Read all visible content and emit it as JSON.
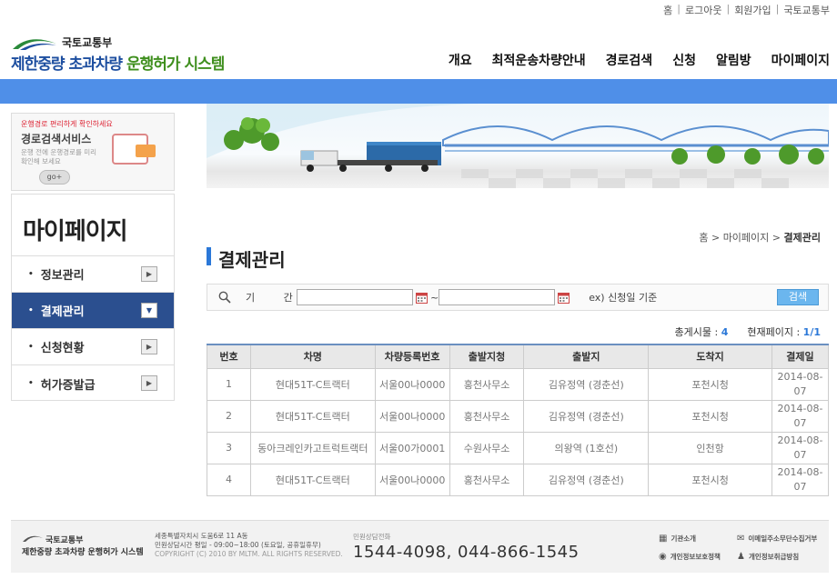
{
  "util_links": [
    "홈",
    "로그아웃",
    "회원가입",
    "국토교통부"
  ],
  "header": {
    "ministry": "국토교통부",
    "system_name_a": "제한중량 초과차량 ",
    "system_name_b": "운행허가 시스템"
  },
  "gnb": [
    "개요",
    "최적운송차량안내",
    "경로검색",
    "신청",
    "알림방",
    "마이페이지"
  ],
  "promo": {
    "subtitle": "운행경로 편리하게 확인하세요",
    "title": "경로검색서비스",
    "desc": "운행 전에 운행경로를 미리 확인해 보세요",
    "go": "go+"
  },
  "sidebar": {
    "title": "마이페이지",
    "items": [
      {
        "label": "정보관리",
        "active": false
      },
      {
        "label": "결제관리",
        "active": true
      },
      {
        "label": "신청현황",
        "active": false
      },
      {
        "label": "허가증발급",
        "active": false
      }
    ]
  },
  "breadcrumb": {
    "home": "홈",
    "sep": ">",
    "level1": "마이페이지",
    "current": "결제관리"
  },
  "page_title": "결제관리",
  "search": {
    "period_label": "기 간 :",
    "start_value": "",
    "end_value": "",
    "tilde": "~",
    "example": "ex) 신청일 기준",
    "button": "검색"
  },
  "counts": {
    "total_label": "총게시물 :",
    "total": "4",
    "page_label": "현재페이지 :",
    "page": "1/1"
  },
  "table": {
    "headers": [
      "번호",
      "차명",
      "차량등록번호",
      "출발지청",
      "출발지",
      "도착지",
      "결제일"
    ],
    "rows": [
      [
        "1",
        "현대51T-C트랙터",
        "서울00나0000",
        "홍천사무소",
        "김유정역 (경춘선)",
        "포천시청",
        "2014-08-07"
      ],
      [
        "2",
        "현대51T-C트랙터",
        "서울00나0000",
        "홍천사무소",
        "김유정역 (경춘선)",
        "포천시청",
        "2014-08-07"
      ],
      [
        "3",
        "동아크레인카고트럭트랙터",
        "서울00가0001",
        "수원사무소",
        "의왕역 (1호선)",
        "인천항",
        "2014-08-07"
      ],
      [
        "4",
        "현대51T-C트랙터",
        "서울00나0000",
        "홍천사무소",
        "김유정역 (경춘선)",
        "포천시청",
        "2014-08-07"
      ]
    ]
  },
  "footer": {
    "ministry": "국토교통부",
    "system": "제한중량 초과차량 운행허가 시스템",
    "address": "세종특별자치시 도움6로 11 A동",
    "hours": "민원상담시간 평일 - 09:00~18:00 (토요일, 공휴일휴무)",
    "copyright": "COPYRIGHT (C) 2010 BY MLTM. ALL RIGHTS RESERVED.",
    "tel_label": "민원상담전화",
    "tel": "1544-4098, 044-866-1545",
    "links": [
      "기관소개",
      "이메일주소무단수집거부",
      "개인정보보호정책",
      "개인정보취급방침"
    ]
  },
  "colors": {
    "accent": "#4f8fe8",
    "sidebar_active": "#2b4f8f",
    "title_bar": "#2b78d8",
    "search_button": "#6bb6ee"
  }
}
